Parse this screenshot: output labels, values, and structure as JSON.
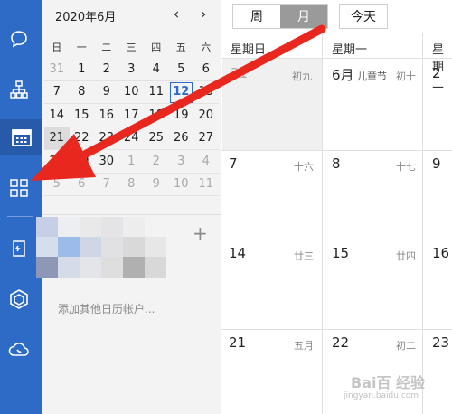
{
  "rail": {
    "icons": [
      "chat-icon",
      "org-chart-icon",
      "calendar-icon",
      "apps-grid-icon",
      "document-icon",
      "hexagon-app-icon",
      "cloud-phone-icon"
    ]
  },
  "mini_calendar": {
    "title": "2020年6月",
    "prev": "‹",
    "next": "›",
    "weekdays": [
      "日",
      "一",
      "二",
      "三",
      "四",
      "五",
      "六"
    ],
    "weeks": [
      [
        "31",
        "1",
        "2",
        "3",
        "4",
        "5",
        "6"
      ],
      [
        "7",
        "8",
        "9",
        "10",
        "11",
        "12",
        "13"
      ],
      [
        "14",
        "15",
        "16",
        "17",
        "18",
        "19",
        "20"
      ],
      [
        "21",
        "22",
        "23",
        "24",
        "25",
        "26",
        "27"
      ],
      [
        "28",
        "29",
        "30",
        "1",
        "2",
        "3",
        "4"
      ],
      [
        "5",
        "6",
        "7",
        "8",
        "9",
        "10",
        "11"
      ]
    ],
    "add_account": "添加其他日历帐户...",
    "plus": "+"
  },
  "view": {
    "week_label": "周",
    "month_label": "月",
    "today_label": "今天",
    "active": "month"
  },
  "month_grid": {
    "headers": [
      "星期日",
      "星期一",
      "星期二"
    ],
    "rows": [
      [
        {
          "day": "31",
          "lunar": "初九"
        },
        {
          "day": "6月",
          "lunar": "初十",
          "holiday": "儿童节"
        },
        {
          "day": "2",
          "lunar": ""
        }
      ],
      [
        {
          "day": "7",
          "lunar": "十六"
        },
        {
          "day": "8",
          "lunar": "十七"
        },
        {
          "day": "9",
          "lunar": ""
        }
      ],
      [
        {
          "day": "14",
          "lunar": "廿三"
        },
        {
          "day": "15",
          "lunar": "廿四"
        },
        {
          "day": "16",
          "lunar": ""
        }
      ],
      [
        {
          "day": "21",
          "lunar": "五月"
        },
        {
          "day": "22",
          "lunar": "初二"
        },
        {
          "day": "23",
          "lunar": ""
        }
      ]
    ]
  },
  "watermark": {
    "brand": "Bai百 经验",
    "url": "jingyan.baidu.com"
  },
  "colors": {
    "rail": "#2e6bc6",
    "arrow": "#e8281f",
    "accent": "#2e6bc6"
  }
}
